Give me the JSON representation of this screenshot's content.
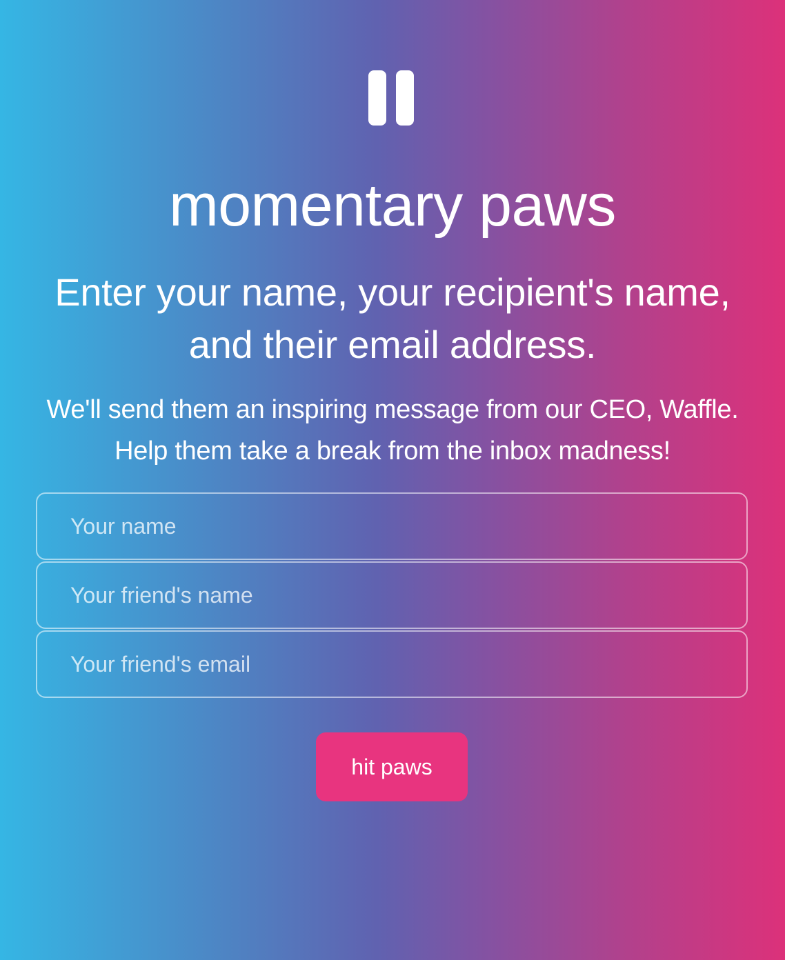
{
  "brand": {
    "icon": "pause-icon",
    "title": "momentary paws"
  },
  "heading": "Enter your name, your recipient's name, and their email address.",
  "description": {
    "line1": "We'll send them an inspiring message from our CEO, Waffle.",
    "line2": "Help them take a break from the inbox madness!"
  },
  "form": {
    "your_name_placeholder": "Your name",
    "friend_name_placeholder": "Your friend's name",
    "friend_email_placeholder": "Your friend's email",
    "submit_label": "hit paws"
  },
  "colors": {
    "gradient_left": "#35b6e4",
    "gradient_right": "#dc317a",
    "button": "#e8347f"
  }
}
